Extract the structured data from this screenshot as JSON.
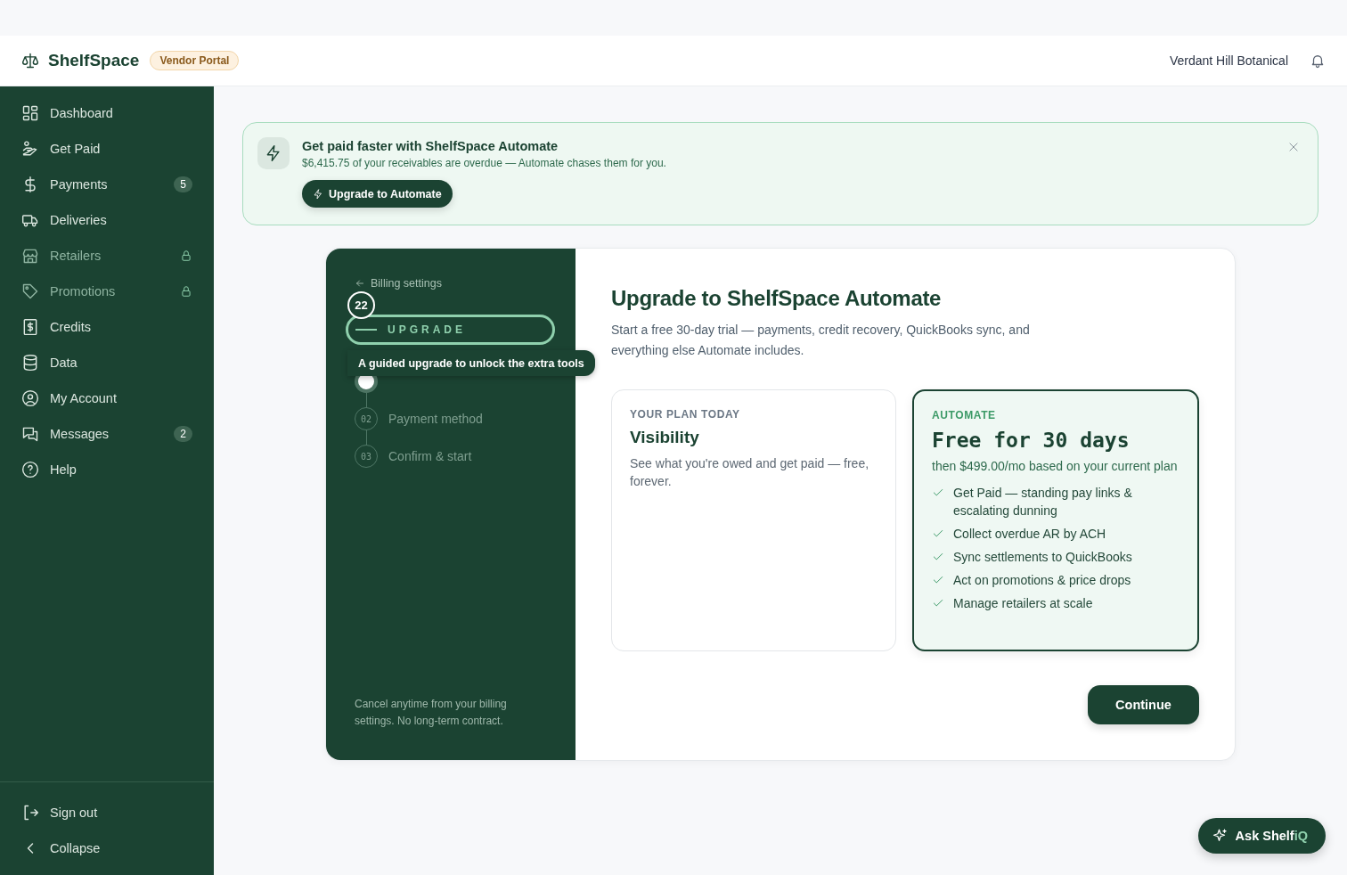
{
  "header": {
    "brand": "ShelfSpace",
    "badge": "Vendor Portal",
    "account": "Verdant Hill Botanical"
  },
  "sidebar": {
    "items": [
      {
        "label": "Dashboard",
        "locked": false,
        "selected": false
      },
      {
        "label": "Get Paid",
        "locked": false,
        "selected": false
      },
      {
        "label": "Payments",
        "badge": "5",
        "locked": false,
        "selected": false
      },
      {
        "label": "Deliveries",
        "locked": false,
        "selected": false
      },
      {
        "label": "Retailers",
        "locked": true,
        "selected": false
      },
      {
        "label": "Promotions",
        "locked": true,
        "selected": false
      },
      {
        "label": "Credits",
        "locked": false,
        "selected": false
      },
      {
        "label": "Data",
        "locked": false,
        "selected": false
      },
      {
        "label": "My Account",
        "locked": false,
        "selected": false
      },
      {
        "label": "Messages",
        "badge": "2",
        "locked": false,
        "selected": false
      },
      {
        "label": "Help",
        "locked": false,
        "selected": false
      }
    ],
    "footer_items": [
      {
        "label": "Sign out"
      },
      {
        "label": "Collapse"
      }
    ]
  },
  "banner": {
    "title": "Get paid faster with ShelfSpace Automate",
    "message": "$6,415.75 of your receivables are overdue — Automate chases them for you.",
    "button": "Upgrade to Automate"
  },
  "wizard": {
    "back": "Billing settings",
    "annotation": {
      "number": "22",
      "label": "UPGRADE",
      "tooltip": "A guided upgrade to unlock the extra tools"
    },
    "steps": [
      {
        "selected": true
      },
      {
        "number": "02",
        "label": "Payment method",
        "selected": false
      },
      {
        "number": "03",
        "label": "Confirm & start",
        "selected": false
      }
    ],
    "note": "Cancel anytime from your billing settings. No long-term contract."
  },
  "content": {
    "title": "Upgrade to ShelfSpace Automate",
    "intro": "Start a free 30-day trial — payments, credit recovery, QuickBooks sync, and everything else Automate includes.",
    "plans": [
      {
        "kind": "current",
        "eyebrow": "YOUR PLAN TODAY",
        "name": "Visibility",
        "description": "See what you're owed and get paid — free, forever."
      },
      {
        "kind": "offer",
        "eyebrow": "AUTOMATE",
        "name": "Free for 30 days",
        "description": "then $499.00/mo based on your current plan",
        "features": [
          "Get Paid — standing pay links & escalating dunning",
          "Collect overdue AR by ACH",
          "Sync settlements to QuickBooks",
          "Act on promotions & price drops",
          "Manage retailers at scale"
        ]
      }
    ],
    "continue": "Continue"
  },
  "assistant": {
    "label": "Ask Shelf",
    "accent": "iQ"
  }
}
